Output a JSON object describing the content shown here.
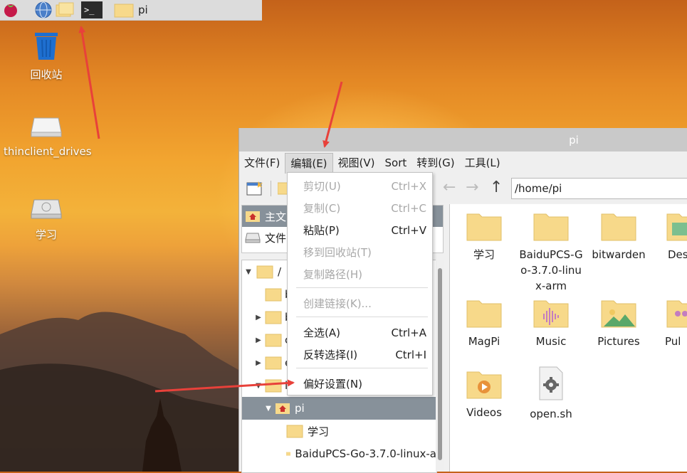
{
  "desktop": {
    "icons": [
      {
        "label": "回收站"
      },
      {
        "label": "thinclient_drives"
      },
      {
        "label": "学习"
      }
    ]
  },
  "taskbar": {
    "task_label": "pi"
  },
  "window": {
    "title": "pi",
    "menus": [
      "文件(F)",
      "编辑(E)",
      "视图(V)",
      "Sort",
      "转到(G)",
      "工具(L)"
    ],
    "address": "/home/pi",
    "places": [
      "主文",
      "文件"
    ],
    "tree": {
      "root": "/",
      "rows": [
        "b",
        "b",
        "c",
        "e",
        "l"
      ],
      "selected": "pi",
      "children": [
        "学习",
        "BaiduPCS-Go-3.7.0-linux-a"
      ]
    },
    "files": [
      {
        "label": "学习"
      },
      {
        "label": "BaiduPCS-Go-3.7.0-linux-arm"
      },
      {
        "label": "bitwarden"
      },
      {
        "label": "Des"
      },
      {
        "label": "MagPi"
      },
      {
        "label": "Music"
      },
      {
        "label": "Pictures"
      },
      {
        "label": "Pul"
      },
      {
        "label": "Videos"
      },
      {
        "label": "open.sh"
      }
    ]
  },
  "edit_menu": {
    "items": [
      {
        "label": "剪切(U)",
        "shortcut": "Ctrl+X"
      },
      {
        "label": "复制(C)",
        "shortcut": "Ctrl+C"
      },
      {
        "label": "粘贴(P)",
        "shortcut": "Ctrl+V"
      },
      {
        "label": "移到回收站(T)",
        "shortcut": ""
      },
      {
        "label": "复制路径(H)",
        "shortcut": ""
      },
      {
        "label": "创建链接(K)...",
        "shortcut": ""
      },
      {
        "label": "全选(A)",
        "shortcut": "Ctrl+A"
      },
      {
        "label": "反转选择(I)",
        "shortcut": "Ctrl+I"
      },
      {
        "label": "偏好设置(N)",
        "shortcut": ""
      }
    ]
  },
  "colors": {
    "folder": "#f7d98a",
    "folder_edge": "#e2c06a",
    "arrow": "#e8413a",
    "selection": "#87919a"
  }
}
